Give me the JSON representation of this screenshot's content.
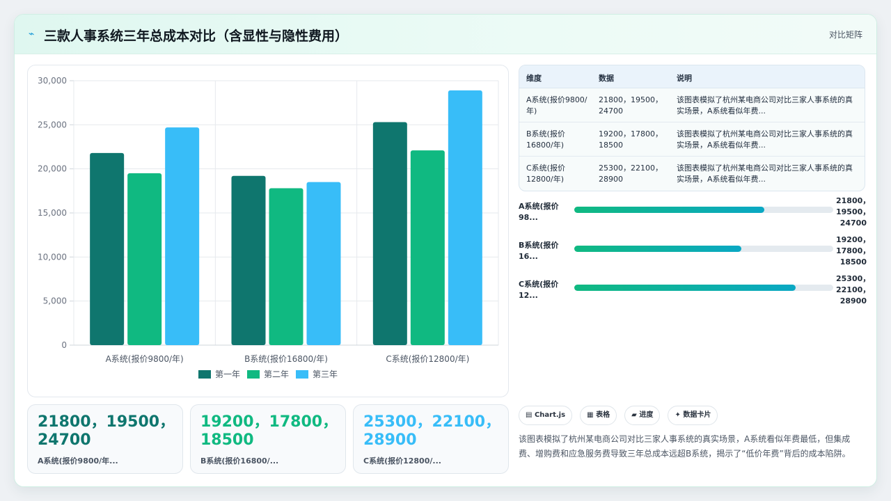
{
  "header": {
    "icon": "wave-icon",
    "title": "三款人事系统三年总成本对比（含显性与隐性费用）",
    "badge": "对比矩阵"
  },
  "chart_data": {
    "type": "bar",
    "categories": [
      "A系统(报价9800/年)",
      "B系统(报价16800/年)",
      "C系统(报价12800/年)"
    ],
    "series": [
      {
        "name": "第一年",
        "values": [
          21800,
          19200,
          25300
        ],
        "color": "#0f766e"
      },
      {
        "name": "第二年",
        "values": [
          19500,
          17800,
          22100
        ],
        "color": "#10b981"
      },
      {
        "name": "第三年",
        "values": [
          24700,
          18500,
          28900
        ],
        "color": "#38bdf8"
      }
    ],
    "ylim": [
      0,
      30000
    ],
    "yticks": [
      "0",
      "5,000",
      "10,000",
      "15,000",
      "20,000",
      "25,000",
      "30,000"
    ],
    "legend_position": "bottom",
    "grid": true
  },
  "table": {
    "headers": [
      "维度",
      "数据",
      "说明"
    ],
    "rows": [
      {
        "dim": "A系统(报价9800/年)",
        "data": "21800，19500，24700",
        "note": "该图表模拟了杭州某电商公司对比三家人事系统的真实场景，A系统看似年费..."
      },
      {
        "dim": "B系统(报价16800/年)",
        "data": "19200，17800，18500",
        "note": "该图表模拟了杭州某电商公司对比三家人事系统的真实场景，A系统看似年费..."
      },
      {
        "dim": "C系统(报价12800/年)",
        "data": "25300，22100，28900",
        "note": "该图表模拟了杭州某电商公司对比三家人事系统的真实场景，A系统看似年费..."
      }
    ]
  },
  "progress": [
    {
      "label": "A系统(报价98...",
      "value": "21800，19500，24700",
      "fill_fraction": 0.735
    },
    {
      "label": "B系统(报价16...",
      "value": "19200，17800，18500",
      "fill_fraction": 0.645
    },
    {
      "label": "C系统(报价12...",
      "value": "25300，22100，28900",
      "fill_fraction": 0.855
    }
  ],
  "stats": [
    {
      "value": "21800，19500，24700",
      "label": "A系统(报价9800/年...",
      "color": "#0f766e"
    },
    {
      "value": "19200，17800，18500",
      "label": "B系统(报价16800/...",
      "color": "#10b981"
    },
    {
      "value": "25300，22100，28900",
      "label": "C系统(报价12800/...",
      "color": "#38bdf8"
    }
  ],
  "chips": [
    {
      "icon": "chart-icon",
      "glyph": "▤",
      "label": "Chart.js"
    },
    {
      "icon": "table-icon",
      "glyph": "▦",
      "label": "表格"
    },
    {
      "icon": "progress-icon",
      "glyph": "▰",
      "label": "进度"
    },
    {
      "icon": "sparkle-icon",
      "glyph": "✦",
      "label": "数据卡片"
    }
  ],
  "description": "该图表模拟了杭州某电商公司对比三家人事系统的真实场景，A系统看似年费最低，但集成费、增购费和应急服务费导致三年总成本远超B系统，揭示了“低价年费”背后的成本陷阱。"
}
